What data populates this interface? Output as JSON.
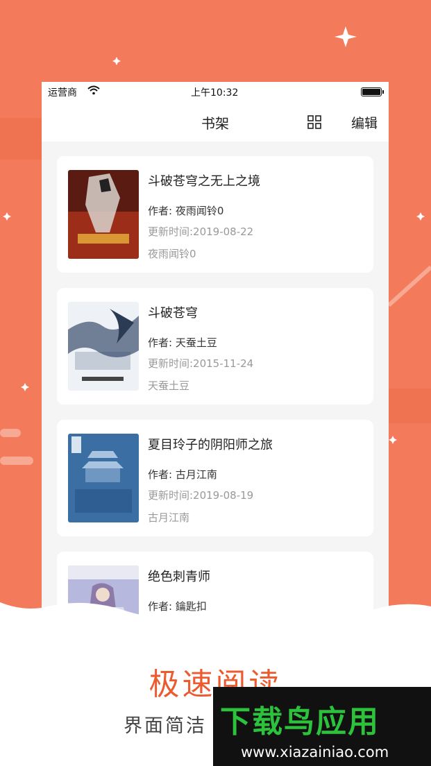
{
  "status_bar": {
    "carrier": "运营商",
    "time": "上午10:32"
  },
  "navbar": {
    "title": "书架",
    "edit_label": "编辑",
    "grid_icon": "grid-icon"
  },
  "books": [
    {
      "name": "斗破苍穹之无上之境",
      "author": "作者: 夜雨闻铃0",
      "updated": "更新时间:2019-08-22",
      "extra": "夜雨闻铃0",
      "cover_color": "#7a2a1a"
    },
    {
      "name": "斗破苍穹",
      "author": "作者: 天蚕土豆",
      "updated": "更新时间:2015-11-24",
      "extra": "天蚕土豆",
      "cover_color": "#dfe6ef"
    },
    {
      "name": "夏目玲子的阴阳师之旅",
      "author": "作者: 古月江南",
      "updated": "更新时间:2019-08-19",
      "extra": "古月江南",
      "cover_color": "#3b6fa3"
    },
    {
      "name": "绝色刺青师",
      "author": "作者: 鑰匙扣",
      "updated": "",
      "extra": "",
      "cover_color": "#b7b8dd"
    }
  ],
  "caption": {
    "title": "极速阅读",
    "subtitle": "界面简洁"
  },
  "watermark": {
    "brand": "下载鸟应用",
    "url": "www.xiazainiao.com"
  },
  "colors": {
    "background": "#f37b5b",
    "accent": "#ec5a30",
    "watermark_green": "#2cc23c"
  }
}
